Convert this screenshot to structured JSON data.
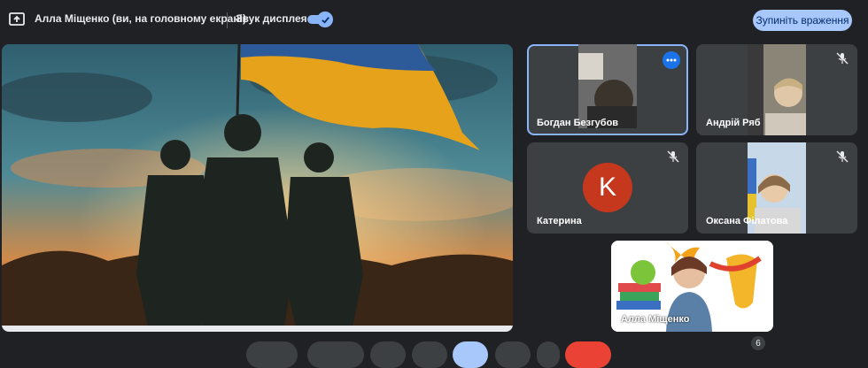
{
  "topbar": {
    "presenting_label": "Алла Міщенко (ви, на головному екрані)",
    "sound_label": "Звук дисплея",
    "sound_enabled": true,
    "stop_button_label": "Зупиніть враження"
  },
  "tiles": [
    {
      "name": "Богдан Безгубов",
      "active_speaker": true
    },
    {
      "name": "Андрій Ряб",
      "muted": true
    },
    {
      "name": "Катерина",
      "muted": true,
      "initial": "K",
      "avatar_color": "#c5381e"
    },
    {
      "name": "Оксана Філатова",
      "muted": true
    },
    {
      "name": "Алла Міщенко"
    }
  ],
  "participants_count": "6",
  "colors": {
    "accent": "#8ab4f8",
    "active_border": "#8ab4f8",
    "end_call": "#ea4335"
  },
  "icons": [
    "present-screen-icon",
    "check-icon",
    "more-options-icon",
    "mic-off-icon"
  ]
}
